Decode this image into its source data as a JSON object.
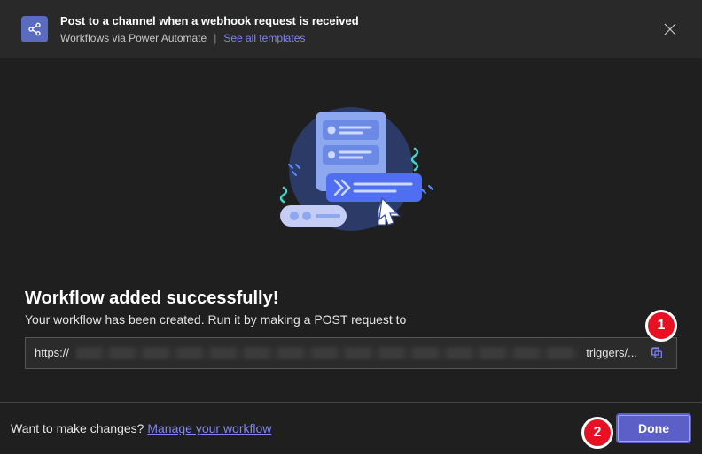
{
  "header": {
    "title": "Post to a channel when a webhook request is received",
    "subtitle": "Workflows via Power Automate",
    "see_all": "See all templates"
  },
  "success": {
    "title": "Workflow added successfully!",
    "subtitle": "Your workflow has been created. Run it by making a POST request to",
    "url_prefix": "https://",
    "url_suffix": "triggers/..."
  },
  "footer": {
    "prompt": "Want to make changes? ",
    "manage_link": "Manage your workflow",
    "done": "Done"
  },
  "annotations": {
    "n1": "1",
    "n2": "2"
  }
}
